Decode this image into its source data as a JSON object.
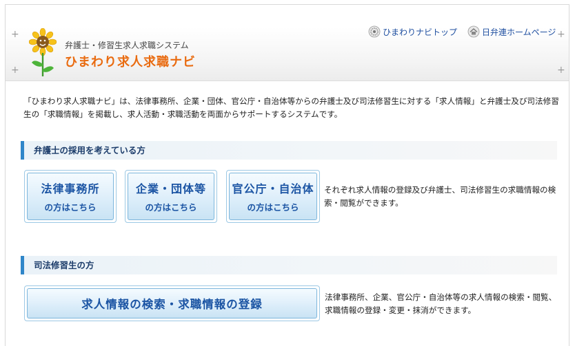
{
  "header": {
    "subtitle": "弁護士・修習生求人求職システム",
    "title": "ひまわり求人求職ナビ",
    "links": [
      {
        "label": "ひまわりナビトップ",
        "icon": "sunflower-emblem-icon"
      },
      {
        "label": "日弁連ホームページ",
        "icon": "home-icon"
      }
    ]
  },
  "intro": "「ひまわり求人求職ナビ」は、法律事務所、企業・団体、官公庁・自治体等からの弁護士及び司法修習生に対する「求人情報」と弁護士及び司法修習生の「求職情報」を掲載し、求人活動・求職活動を両面からサポートするシステムです。",
  "employers": {
    "heading": "弁護士の採用を考えている方",
    "buttons": [
      {
        "line1": "法律事務所",
        "line2": "の方はこちら"
      },
      {
        "line1": "企業・団体等",
        "line2": "の方はこちら"
      },
      {
        "line1": "官公庁・自治体",
        "line2": "の方はこちら"
      }
    ],
    "description": "それぞれ求人情報の登録及び弁護士、司法修習生の求職情報の検索・閲覧ができます。"
  },
  "trainees": {
    "heading": "司法修習生の方",
    "button": "求人情報の検索・求職情報の登録",
    "description": "法律事務所、企業、官公庁・自治体等の求人情報の検索・閲覧、求職情報の登録・変更・抹消ができます。"
  },
  "colors": {
    "accent": "#2f86c9",
    "title_orange": "#e96b10",
    "link_blue": "#1f4fa0"
  }
}
